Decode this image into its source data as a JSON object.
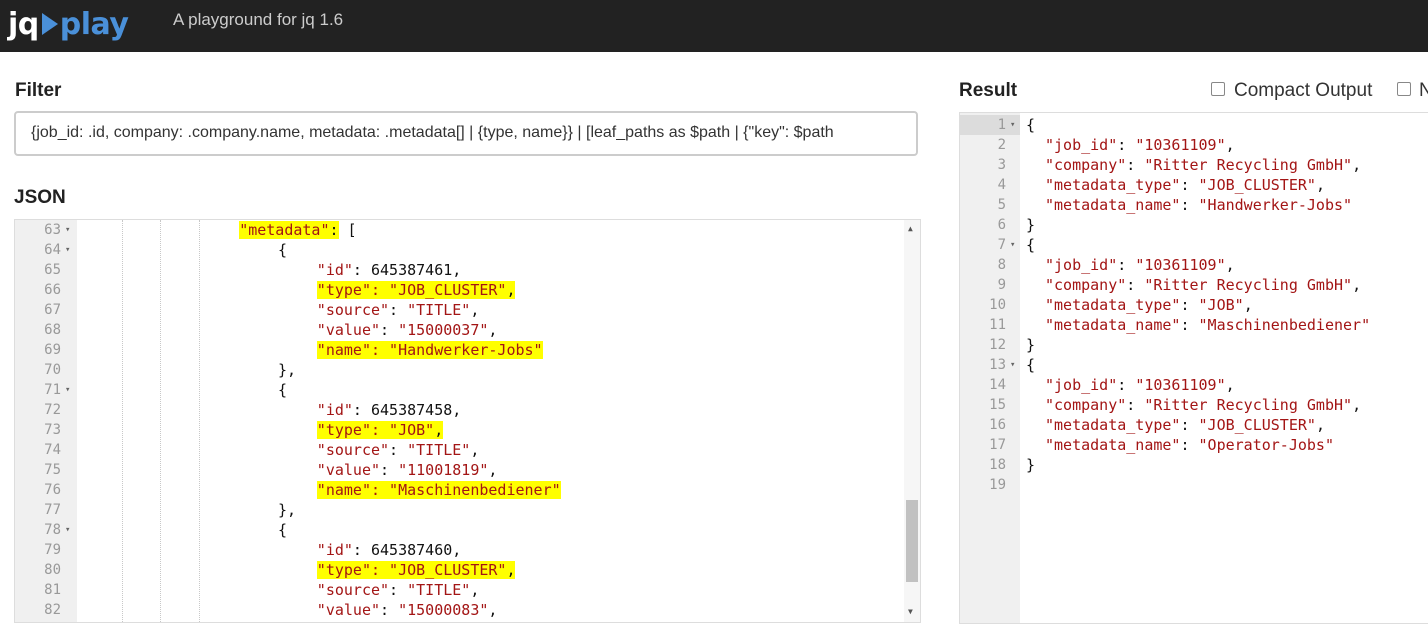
{
  "header": {
    "logo_jq": "jq",
    "logo_play": "play",
    "tagline": "A playground for jq 1.6"
  },
  "filter": {
    "label": "Filter",
    "value": "{job_id: .id, company: .company.name, metadata: .metadata[] | {type, name}} | [leaf_paths as $path | {\"key\": $path"
  },
  "json_input": {
    "label": "JSON",
    "lines": [
      {
        "n": "63",
        "indent": 4,
        "fold": true,
        "tokens": [
          {
            "t": "k",
            "v": "\"metadata\"",
            "hl": true
          },
          {
            "t": "p",
            "v": ":",
            "hl": true
          },
          {
            "t": "p",
            "v": " ["
          }
        ]
      },
      {
        "n": "64",
        "indent": 5,
        "fold": true,
        "tokens": [
          {
            "t": "p",
            "v": "{"
          }
        ]
      },
      {
        "n": "65",
        "indent": 6,
        "tokens": [
          {
            "t": "k",
            "v": "\"id\""
          },
          {
            "t": "p",
            "v": ": "
          },
          {
            "t": "n",
            "v": "645387461"
          },
          {
            "t": "p",
            "v": ","
          }
        ]
      },
      {
        "n": "66",
        "indent": 6,
        "tokens": [
          {
            "t": "k",
            "v": "\"type\": ",
            "hl": true
          },
          {
            "t": "s",
            "v": "\"JOB_CLUSTER\"",
            "hl": true
          },
          {
            "t": "p",
            "v": ",",
            "hl": true
          }
        ]
      },
      {
        "n": "67",
        "indent": 6,
        "tokens": [
          {
            "t": "k",
            "v": "\"source\""
          },
          {
            "t": "p",
            "v": ": "
          },
          {
            "t": "s",
            "v": "\"TITLE\""
          },
          {
            "t": "p",
            "v": ","
          }
        ]
      },
      {
        "n": "68",
        "indent": 6,
        "tokens": [
          {
            "t": "k",
            "v": "\"value\""
          },
          {
            "t": "p",
            "v": ": "
          },
          {
            "t": "s",
            "v": "\"15000037\""
          },
          {
            "t": "p",
            "v": ","
          }
        ]
      },
      {
        "n": "69",
        "indent": 6,
        "tokens": [
          {
            "t": "k",
            "v": "\"name\": ",
            "hl": true
          },
          {
            "t": "s",
            "v": "\"Handwerker-Jobs\"",
            "hl": true
          }
        ]
      },
      {
        "n": "70",
        "indent": 5,
        "tokens": [
          {
            "t": "p",
            "v": "},"
          }
        ]
      },
      {
        "n": "71",
        "indent": 5,
        "fold": true,
        "tokens": [
          {
            "t": "p",
            "v": "{"
          }
        ]
      },
      {
        "n": "72",
        "indent": 6,
        "tokens": [
          {
            "t": "k",
            "v": "\"id\""
          },
          {
            "t": "p",
            "v": ": "
          },
          {
            "t": "n",
            "v": "645387458"
          },
          {
            "t": "p",
            "v": ","
          }
        ]
      },
      {
        "n": "73",
        "indent": 6,
        "tokens": [
          {
            "t": "k",
            "v": "\"type\": ",
            "hl": true
          },
          {
            "t": "s",
            "v": "\"JOB\"",
            "hl": true
          },
          {
            "t": "p",
            "v": ",",
            "hl": true
          }
        ]
      },
      {
        "n": "74",
        "indent": 6,
        "tokens": [
          {
            "t": "k",
            "v": "\"source\""
          },
          {
            "t": "p",
            "v": ": "
          },
          {
            "t": "s",
            "v": "\"TITLE\""
          },
          {
            "t": "p",
            "v": ","
          }
        ]
      },
      {
        "n": "75",
        "indent": 6,
        "tokens": [
          {
            "t": "k",
            "v": "\"value\""
          },
          {
            "t": "p",
            "v": ": "
          },
          {
            "t": "s",
            "v": "\"11001819\""
          },
          {
            "t": "p",
            "v": ","
          }
        ]
      },
      {
        "n": "76",
        "indent": 6,
        "tokens": [
          {
            "t": "k",
            "v": "\"name\": ",
            "hl": true
          },
          {
            "t": "s",
            "v": "\"Maschinenbediener\"",
            "hl": true
          }
        ]
      },
      {
        "n": "77",
        "indent": 5,
        "tokens": [
          {
            "t": "p",
            "v": "},"
          }
        ]
      },
      {
        "n": "78",
        "indent": 5,
        "fold": true,
        "tokens": [
          {
            "t": "p",
            "v": "{"
          }
        ]
      },
      {
        "n": "79",
        "indent": 6,
        "tokens": [
          {
            "t": "k",
            "v": "\"id\""
          },
          {
            "t": "p",
            "v": ": "
          },
          {
            "t": "n",
            "v": "645387460"
          },
          {
            "t": "p",
            "v": ","
          }
        ]
      },
      {
        "n": "80",
        "indent": 6,
        "tokens": [
          {
            "t": "k",
            "v": "\"type\": ",
            "hl": true
          },
          {
            "t": "s",
            "v": "\"JOB_CLUSTER\"",
            "hl": true
          },
          {
            "t": "p",
            "v": ",",
            "hl": true
          }
        ]
      },
      {
        "n": "81",
        "indent": 6,
        "tokens": [
          {
            "t": "k",
            "v": "\"source\""
          },
          {
            "t": "p",
            "v": ": "
          },
          {
            "t": "s",
            "v": "\"TITLE\""
          },
          {
            "t": "p",
            "v": ","
          }
        ]
      },
      {
        "n": "82",
        "indent": 6,
        "tokens": [
          {
            "t": "k",
            "v": "\"value\""
          },
          {
            "t": "p",
            "v": ": "
          },
          {
            "t": "s",
            "v": "\"15000083\""
          },
          {
            "t": "p",
            "v": ","
          }
        ]
      }
    ]
  },
  "result": {
    "label": "Result",
    "compact_output_label": "Compact Output",
    "compact_output_checked": false,
    "next_option_label": "N",
    "next_option_checked": false,
    "lines": [
      {
        "n": "1",
        "indent": 0,
        "fold": true,
        "tokens": [
          {
            "t": "p",
            "v": "{"
          }
        ]
      },
      {
        "n": "2",
        "indent": 1,
        "tokens": [
          {
            "t": "k",
            "v": "\"job_id\""
          },
          {
            "t": "p",
            "v": ": "
          },
          {
            "t": "s",
            "v": "\"10361109\""
          },
          {
            "t": "p",
            "v": ","
          }
        ]
      },
      {
        "n": "3",
        "indent": 1,
        "tokens": [
          {
            "t": "k",
            "v": "\"company\""
          },
          {
            "t": "p",
            "v": ": "
          },
          {
            "t": "s",
            "v": "\"Ritter Recycling GmbH\""
          },
          {
            "t": "p",
            "v": ","
          }
        ]
      },
      {
        "n": "4",
        "indent": 1,
        "tokens": [
          {
            "t": "k",
            "v": "\"metadata_type\""
          },
          {
            "t": "p",
            "v": ": "
          },
          {
            "t": "s",
            "v": "\"JOB_CLUSTER\""
          },
          {
            "t": "p",
            "v": ","
          }
        ]
      },
      {
        "n": "5",
        "indent": 1,
        "tokens": [
          {
            "t": "k",
            "v": "\"metadata_name\""
          },
          {
            "t": "p",
            "v": ": "
          },
          {
            "t": "s",
            "v": "\"Handwerker-Jobs\""
          }
        ]
      },
      {
        "n": "6",
        "indent": 0,
        "tokens": [
          {
            "t": "p",
            "v": "}"
          }
        ]
      },
      {
        "n": "7",
        "indent": 0,
        "fold": true,
        "tokens": [
          {
            "t": "p",
            "v": "{"
          }
        ]
      },
      {
        "n": "8",
        "indent": 1,
        "tokens": [
          {
            "t": "k",
            "v": "\"job_id\""
          },
          {
            "t": "p",
            "v": ": "
          },
          {
            "t": "s",
            "v": "\"10361109\""
          },
          {
            "t": "p",
            "v": ","
          }
        ]
      },
      {
        "n": "9",
        "indent": 1,
        "tokens": [
          {
            "t": "k",
            "v": "\"company\""
          },
          {
            "t": "p",
            "v": ": "
          },
          {
            "t": "s",
            "v": "\"Ritter Recycling GmbH\""
          },
          {
            "t": "p",
            "v": ","
          }
        ]
      },
      {
        "n": "10",
        "indent": 1,
        "tokens": [
          {
            "t": "k",
            "v": "\"metadata_type\""
          },
          {
            "t": "p",
            "v": ": "
          },
          {
            "t": "s",
            "v": "\"JOB\""
          },
          {
            "t": "p",
            "v": ","
          }
        ]
      },
      {
        "n": "11",
        "indent": 1,
        "tokens": [
          {
            "t": "k",
            "v": "\"metadata_name\""
          },
          {
            "t": "p",
            "v": ": "
          },
          {
            "t": "s",
            "v": "\"Maschinenbediener\""
          }
        ]
      },
      {
        "n": "12",
        "indent": 0,
        "tokens": [
          {
            "t": "p",
            "v": "}"
          }
        ]
      },
      {
        "n": "13",
        "indent": 0,
        "fold": true,
        "tokens": [
          {
            "t": "p",
            "v": "{"
          }
        ]
      },
      {
        "n": "14",
        "indent": 1,
        "tokens": [
          {
            "t": "k",
            "v": "\"job_id\""
          },
          {
            "t": "p",
            "v": ": "
          },
          {
            "t": "s",
            "v": "\"10361109\""
          },
          {
            "t": "p",
            "v": ","
          }
        ]
      },
      {
        "n": "15",
        "indent": 1,
        "tokens": [
          {
            "t": "k",
            "v": "\"company\""
          },
          {
            "t": "p",
            "v": ": "
          },
          {
            "t": "s",
            "v": "\"Ritter Recycling GmbH\""
          },
          {
            "t": "p",
            "v": ","
          }
        ]
      },
      {
        "n": "16",
        "indent": 1,
        "tokens": [
          {
            "t": "k",
            "v": "\"metadata_type\""
          },
          {
            "t": "p",
            "v": ": "
          },
          {
            "t": "s",
            "v": "\"JOB_CLUSTER\""
          },
          {
            "t": "p",
            "v": ","
          }
        ]
      },
      {
        "n": "17",
        "indent": 1,
        "tokens": [
          {
            "t": "k",
            "v": "\"metadata_name\""
          },
          {
            "t": "p",
            "v": ": "
          },
          {
            "t": "s",
            "v": "\"Operator-Jobs\""
          }
        ]
      },
      {
        "n": "18",
        "indent": 0,
        "tokens": [
          {
            "t": "p",
            "v": "}"
          }
        ]
      },
      {
        "n": "19",
        "indent": 0,
        "tokens": []
      }
    ]
  },
  "colors": {
    "topbar": "#222222",
    "logo_accent": "#4a90d9",
    "code_string": "#a31515",
    "highlight": "#ffff00"
  }
}
